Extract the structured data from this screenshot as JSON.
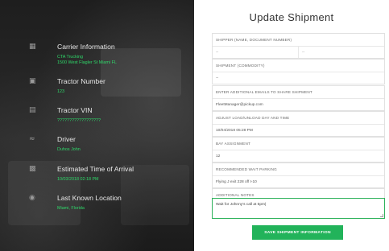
{
  "carrier": {
    "title": "Carrier Information",
    "name": "CTA Trucking",
    "address": "1500 West Flagler St Miami FL"
  },
  "tractor_number": {
    "title": "Tractor Number",
    "value": "123"
  },
  "tractor_vin": {
    "title": "Tractor VIN",
    "value": "??????????????????"
  },
  "driver": {
    "title": "Driver",
    "value": "Duhos John"
  },
  "eta": {
    "title": "Estimated Time of Arrival",
    "value": "10/03/2018 02:18 PM"
  },
  "location": {
    "title": "Last Known Location",
    "value": "Miami, Florida"
  },
  "form": {
    "title": "Update Shipment",
    "shipper_label": "Shipper (Name, Document Number)",
    "shipper_left_placeholder": "--",
    "shipper_right_placeholder": "--",
    "shipment_label": "Shipment (Commodity)",
    "shipment_value": "--",
    "emails_label": "Enter Additional Emails to Share Shipment",
    "emails_value": "FleetManager@pickup.com",
    "adjust_label": "Adjust Load/Unload Day and Time",
    "adjust_value": "10/04/2018 05:28 PM",
    "bay_label": "Bay Assignment",
    "bay_value": "12",
    "parking_label": "Recommended Wait Parking",
    "parking_value": "Flying J exit 228 off I-10",
    "notes_label": "Additional Notes",
    "notes_value": "Wait for Johnny's call at 5pm|",
    "save_label": "Save Shipment Information"
  },
  "icons": {
    "carrier": "building-icon",
    "tractor_number": "truck-icon",
    "tractor_vin": "barcode-icon",
    "driver": "driver-icon",
    "eta": "calendar-icon",
    "location": "map-pin-icon"
  },
  "colors": {
    "accent": "#22b35a",
    "value_green": "#2fd96a",
    "left_bg": "#222222"
  }
}
